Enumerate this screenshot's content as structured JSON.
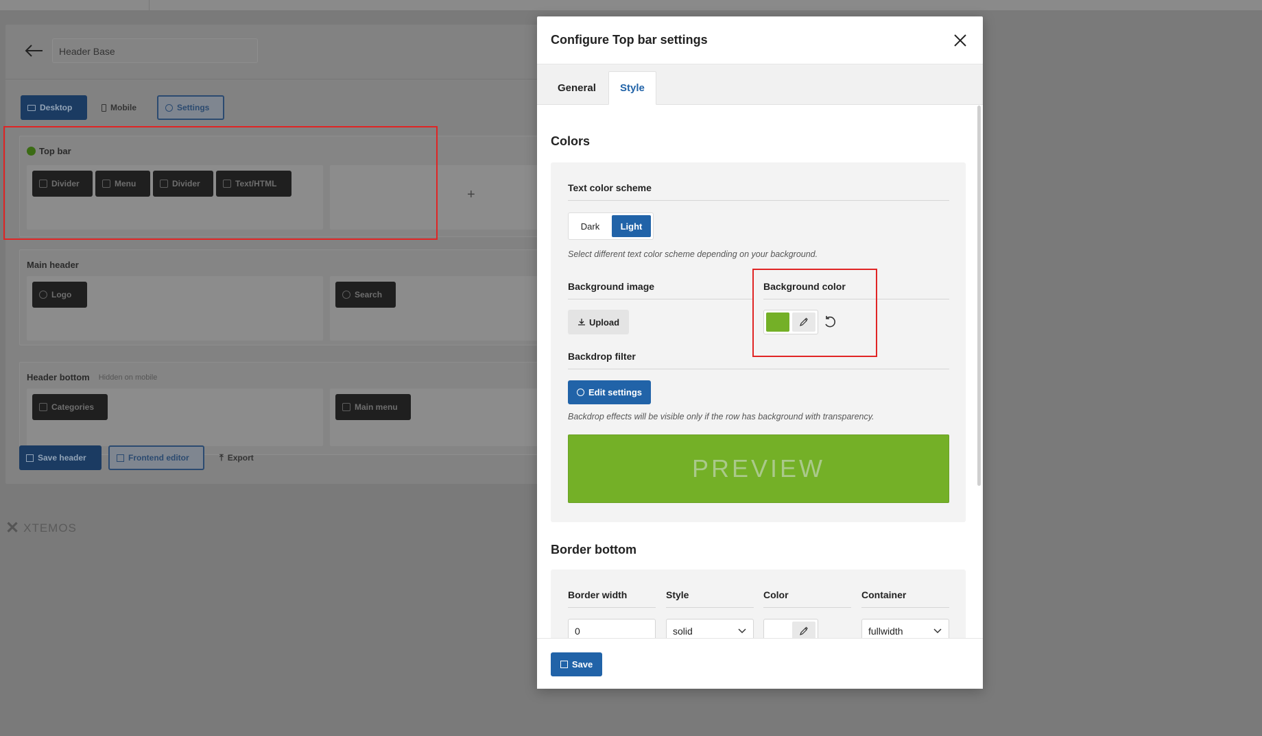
{
  "background": {
    "header_name": "Header Base",
    "device_tabs": {
      "desktop": "Desktop",
      "mobile": "Mobile",
      "settings": "Settings"
    },
    "rows": {
      "top_bar": {
        "title": "Top bar",
        "elements": [
          "Divider",
          "Menu",
          "Divider",
          "Text/HTML"
        ]
      },
      "main_header": {
        "title": "Main header",
        "left_element": "Logo",
        "center_element": "Search"
      },
      "header_bottom": {
        "title": "Header bottom",
        "note": "Hidden on mobile",
        "left_element": "Categories",
        "center_element": "Main menu"
      }
    },
    "actions": {
      "save": "Save header",
      "frontend": "Frontend editor",
      "export": "Export"
    },
    "brand": "XTEMOS",
    "add_symbol": "+"
  },
  "modal": {
    "title": "Configure Top bar settings",
    "tabs": {
      "general": "General",
      "style": "Style"
    },
    "active_tab": "Style",
    "colors": {
      "heading": "Colors",
      "text_scheme_label": "Text color scheme",
      "scheme_dark": "Dark",
      "scheme_light": "Light",
      "selected_scheme": "Light",
      "scheme_hint": "Select different text color scheme depending on your background.",
      "bg_image_label": "Background image",
      "upload_label": "Upload",
      "bg_color_label": "Background color",
      "bg_color_value": "#74b027",
      "backdrop_label": "Backdrop filter",
      "edit_settings_label": "Edit settings",
      "backdrop_hint": "Backdrop effects will be visible only if the row has background with transparency.",
      "preview_text": "PREVIEW"
    },
    "border_bottom": {
      "heading": "Border bottom",
      "width_label": "Border width",
      "width_value": "0",
      "style_label": "Style",
      "style_value": "solid",
      "color_label": "Color",
      "container_label": "Container",
      "container_value": "fullwidth"
    },
    "save_label": "Save"
  },
  "colors": {
    "accent": "#2163a8",
    "highlight_red": "#e02424",
    "status_green": "#74b027"
  }
}
